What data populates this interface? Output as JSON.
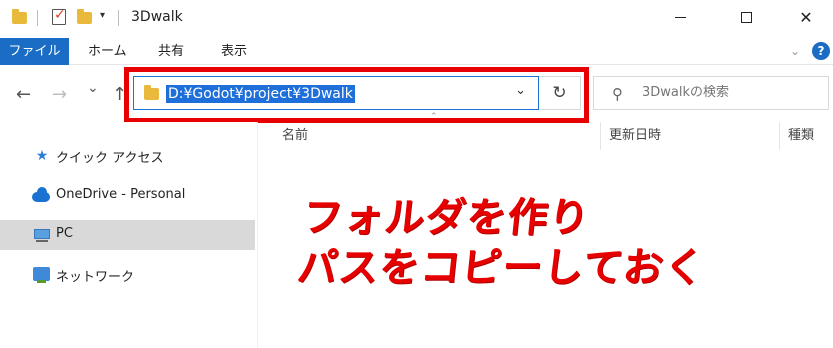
{
  "window": {
    "title": "3Dwalk",
    "minimize_glyph": "—",
    "close_glyph": "✕"
  },
  "ribbon": {
    "tabs": [
      "ファイル",
      "ホーム",
      "共有",
      "表示"
    ],
    "help_glyph": "?",
    "accent_color": "#1a6cc4"
  },
  "nav": {
    "back_glyph": "←",
    "forward_glyph": "→",
    "recent_glyph": "⌄",
    "up_glyph": "↑",
    "address_path": "D:¥Godot¥project¥3Dwalk",
    "refresh_glyph": "↻",
    "search_placeholder": "3Dwalkの検索",
    "search_glyph": "⚲"
  },
  "sidebar": {
    "items": [
      {
        "label": "クイック アクセス",
        "icon": "star-icon"
      },
      {
        "label": "OneDrive - Personal",
        "icon": "cloud-icon"
      },
      {
        "label": "PC",
        "icon": "computer-icon",
        "selected": true
      },
      {
        "label": "ネットワーク",
        "icon": "network-icon"
      }
    ]
  },
  "columns": [
    "名前",
    "更新日時",
    "種類"
  ],
  "annotation": {
    "line1": "フォルダを作り",
    "line2": "パスをコピーしておく",
    "color": "#e60000"
  }
}
